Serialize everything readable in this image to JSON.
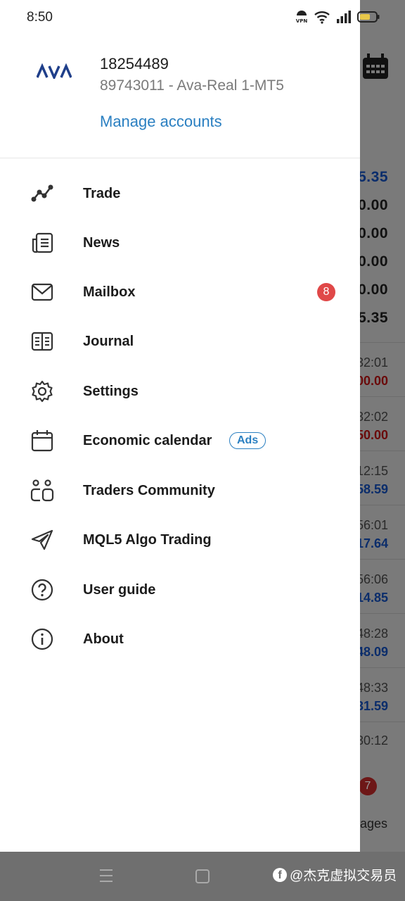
{
  "status_bar": {
    "time": "8:50",
    "vpn_label": "VPN"
  },
  "account": {
    "number": "18254489",
    "server": "89743011 - Ava-Real 1-MT5",
    "manage_label": "Manage accounts"
  },
  "menu": {
    "items": [
      {
        "label": "Trade",
        "icon": "trade-line-icon"
      },
      {
        "label": "News",
        "icon": "news-icon"
      },
      {
        "label": "Mailbox",
        "icon": "mail-icon",
        "badge": "8"
      },
      {
        "label": "Journal",
        "icon": "journal-icon"
      },
      {
        "label": "Settings",
        "icon": "gear-icon"
      },
      {
        "label": "Economic calendar",
        "icon": "calendar-icon",
        "tag": "Ads"
      },
      {
        "label": "Traders Community",
        "icon": "community-icon"
      },
      {
        "label": "MQL5 Algo Trading",
        "icon": "send-icon"
      },
      {
        "label": "User guide",
        "icon": "question-icon"
      },
      {
        "label": "About",
        "icon": "info-icon"
      }
    ]
  },
  "background": {
    "values": [
      "5.35",
      "0.00",
      "0.00",
      "0.00",
      "0.00",
      "5.35"
    ],
    "rows": [
      {
        "time": "32:01",
        "amount": "00.00",
        "color": "red"
      },
      {
        "time": "32:02",
        "amount": "50.00",
        "color": "red"
      },
      {
        "time": "12:15",
        "amount": "58.59",
        "color": "blue"
      },
      {
        "time": "56:01",
        "amount": "17.64",
        "color": "blue"
      },
      {
        "time": "56:06",
        "amount": "14.85",
        "color": "blue"
      },
      {
        "time": "48:28",
        "amount": "48.09",
        "color": "blue"
      },
      {
        "time": "48:33",
        "amount": "31.59",
        "color": "blue"
      },
      {
        "time": "30:12",
        "amount": "",
        "color": "blue"
      }
    ],
    "messages_badge": "7",
    "messages_label": "ages"
  },
  "watermark": {
    "text": "@杰克虚拟交易员"
  },
  "colors": {
    "accent": "#2a7fc1",
    "badge": "#e04848",
    "overlay": "#7a7a7a"
  }
}
